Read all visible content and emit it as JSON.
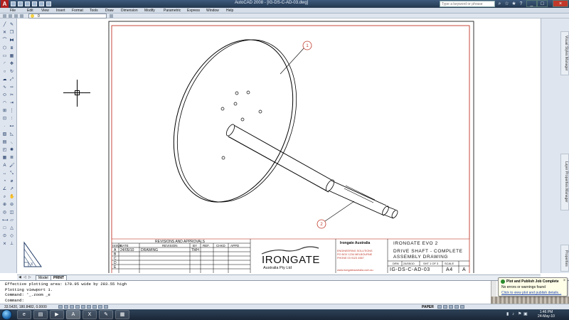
{
  "window": {
    "title": "AutoCAD 2008 - [IG-DS-C-AD-03.dwg]",
    "search_placeholder": "Type a keyword or phrase",
    "minimize": "_",
    "maximize": "□",
    "close": "×"
  },
  "menu": [
    "File",
    "Edit",
    "View",
    "Insert",
    "Format",
    "Tools",
    "Draw",
    "Dimension",
    "Modify",
    "Parametric",
    "Express",
    "Window",
    "Help"
  ],
  "toolbar": {
    "layer_value": "0"
  },
  "drawing": {
    "callout_1": "1",
    "callout_2": "2"
  },
  "title_block": {
    "revisions_header": "REVISIONS AND APPROVALS",
    "columns": [
      "ISSUE",
      "DATE",
      "REVISION",
      "BY",
      "REF.",
      "CHKD",
      "APPD"
    ],
    "rows": [
      {
        "issue": "A",
        "date": "24/05/10",
        "revision": "DRAWING",
        "by": "TMH"
      },
      {
        "issue": "B"
      },
      {
        "issue": "C"
      },
      {
        "issue": "D"
      },
      {
        "issue": "E"
      }
    ],
    "logo_text": "IRONGATE",
    "logo_sub": "Australia Pty Ltd",
    "company_name": "Irongate Australia",
    "company_line1": "ENGINEERING SOLUTIONS",
    "company_line2": "PO BOX 1234 MELBOURNE",
    "company_line3": "PHONE 03 9123 4567",
    "company_line4": "www.irongateaustralia.com.au",
    "project": "IRONGATE EVO 2",
    "title_line1": "DRIVE SHAFT - COMPLETE",
    "title_line2": "ASSEMBLY DRAWING",
    "meta_labels": [
      "DRN",
      "24/05/10",
      "SHT 1 OF 3",
      "SCALE"
    ],
    "drawing_number": "IG-DS-C-AD-03",
    "sheet_size": "A4",
    "revision": "A"
  },
  "layout_tabs": [
    "Model",
    "PRINT"
  ],
  "command": {
    "lines": [
      "Effective plotting area:  170.95 wide by 283.55 high",
      "Plotting viewport 1.",
      "Command: '_.zoom _e",
      "Command:"
    ]
  },
  "status": {
    "coordinates": "33.5420, 180.8482, 0.0000",
    "space": "PAPER"
  },
  "right_panels": [
    "Visual Styles Manager",
    "Layer Properties Manager",
    "Properties"
  ],
  "notification": {
    "title": "Plot and Publish Job Complete",
    "message": "No errors or warnings found",
    "link": "Click to view plot and publish details..."
  },
  "taskbar": {
    "time": "1:46 PM",
    "date": "24-May-10"
  }
}
